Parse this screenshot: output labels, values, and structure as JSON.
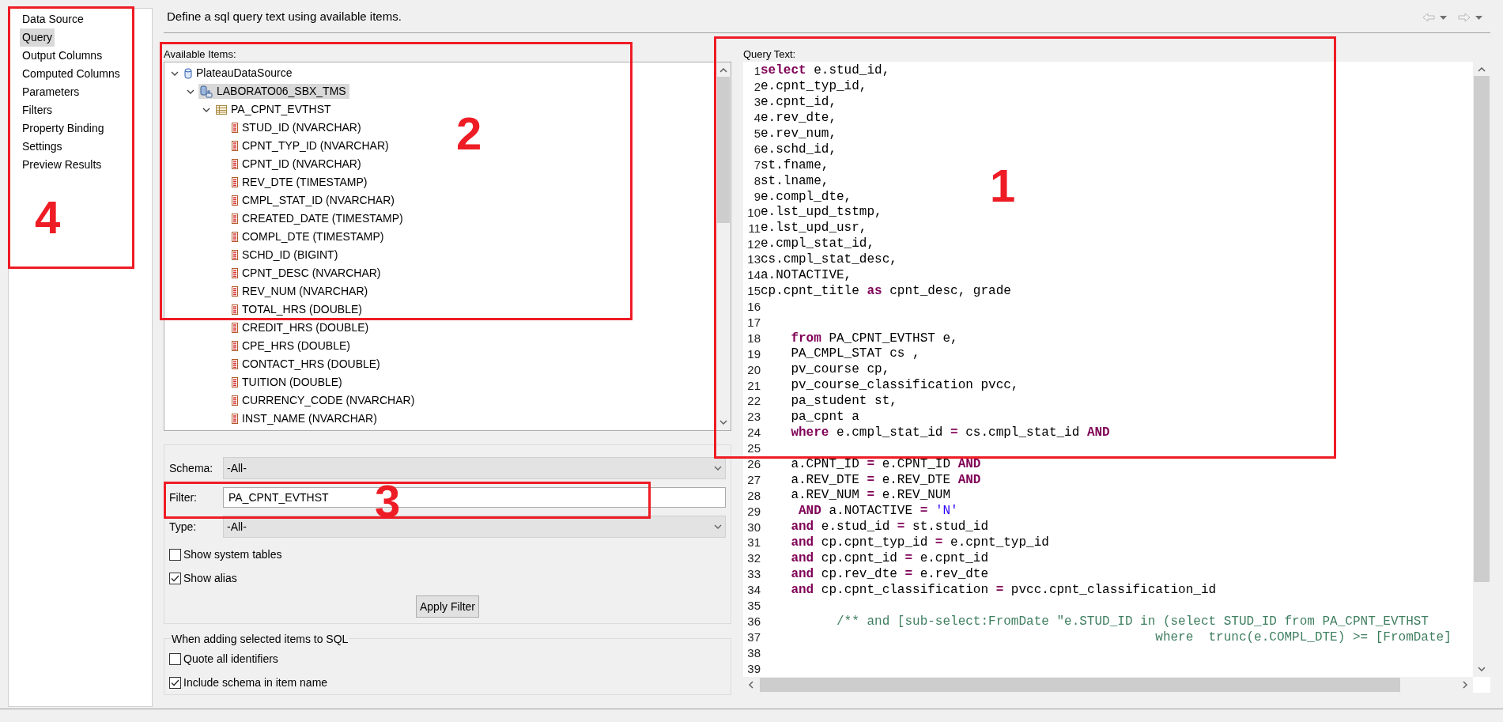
{
  "sidebar": {
    "items": [
      {
        "label": "Data Source",
        "selected": false
      },
      {
        "label": "Query",
        "selected": true
      },
      {
        "label": "Output Columns",
        "selected": false
      },
      {
        "label": "Computed Columns",
        "selected": false
      },
      {
        "label": "Parameters",
        "selected": false
      },
      {
        "label": "Filters",
        "selected": false
      },
      {
        "label": "Property Binding",
        "selected": false
      },
      {
        "label": "Settings",
        "selected": false
      },
      {
        "label": "Preview Results",
        "selected": false
      }
    ]
  },
  "header": {
    "title": "Define a sql query text using available items."
  },
  "available_items": {
    "label": "Available Items:",
    "tree": [
      {
        "label": "PlateauDataSource",
        "kind": "datasource",
        "expanded": true,
        "selected": false,
        "children": [
          {
            "label": "LABORATO06_SBX_TMS",
            "kind": "schema",
            "expanded": true,
            "selected": true,
            "children": [
              {
                "label": "PA_CPNT_EVTHST",
                "kind": "table",
                "expanded": true,
                "selected": false,
                "children": [
                  {
                    "label": "STUD_ID (NVARCHAR)",
                    "kind": "column",
                    "selected": false
                  },
                  {
                    "label": "CPNT_TYP_ID (NVARCHAR)",
                    "kind": "column",
                    "selected": false
                  },
                  {
                    "label": "CPNT_ID (NVARCHAR)",
                    "kind": "column",
                    "selected": false
                  },
                  {
                    "label": "REV_DTE (TIMESTAMP)",
                    "kind": "column",
                    "selected": false
                  },
                  {
                    "label": "CMPL_STAT_ID (NVARCHAR)",
                    "kind": "column",
                    "selected": false
                  },
                  {
                    "label": "CREATED_DATE (TIMESTAMP)",
                    "kind": "column",
                    "selected": false
                  },
                  {
                    "label": "COMPL_DTE (TIMESTAMP)",
                    "kind": "column",
                    "selected": false
                  },
                  {
                    "label": "SCHD_ID (BIGINT)",
                    "kind": "column",
                    "selected": false
                  },
                  {
                    "label": "CPNT_DESC (NVARCHAR)",
                    "kind": "column",
                    "selected": false
                  },
                  {
                    "label": "REV_NUM (NVARCHAR)",
                    "kind": "column",
                    "selected": false
                  },
                  {
                    "label": "TOTAL_HRS (DOUBLE)",
                    "kind": "column",
                    "selected": false
                  },
                  {
                    "label": "CREDIT_HRS (DOUBLE)",
                    "kind": "column",
                    "selected": false
                  },
                  {
                    "label": "CPE_HRS (DOUBLE)",
                    "kind": "column",
                    "selected": false
                  },
                  {
                    "label": "CONTACT_HRS (DOUBLE)",
                    "kind": "column",
                    "selected": false
                  },
                  {
                    "label": "TUITION (DOUBLE)",
                    "kind": "column",
                    "selected": false
                  },
                  {
                    "label": "CURRENCY_CODE (NVARCHAR)",
                    "kind": "column",
                    "selected": false
                  },
                  {
                    "label": "INST_NAME (NVARCHAR)",
                    "kind": "column",
                    "selected": false
                  }
                ]
              }
            ]
          }
        ]
      }
    ]
  },
  "filter_panel": {
    "schema": {
      "label": "Schema:",
      "value": "-All-"
    },
    "filter": {
      "label": "Filter:",
      "value": "PA_CPNT_EVTHST"
    },
    "type": {
      "label": "Type:",
      "value": "-All-"
    },
    "options": [
      {
        "label": "Show system tables",
        "checked": false
      },
      {
        "label": "Show alias",
        "checked": true
      }
    ],
    "apply_button": "Apply Filter"
  },
  "sql_options": {
    "title": "When adding selected items to SQL",
    "options": [
      {
        "label": "Quote all identifiers",
        "checked": false
      },
      {
        "label": "Include schema in item name",
        "checked": true
      }
    ]
  },
  "query": {
    "label": "Query Text:",
    "lines": [
      {
        "number": "1",
        "kind": "code",
        "text": "**select** e.stud_id,"
      },
      {
        "number": "2",
        "kind": "code",
        "text": "e.cpnt_typ_id,"
      },
      {
        "number": "3",
        "kind": "code",
        "text": "e.cpnt_id,"
      },
      {
        "number": "4",
        "kind": "code",
        "text": "e.rev_dte,"
      },
      {
        "number": "5",
        "kind": "code",
        "text": "e.rev_num,"
      },
      {
        "number": "6",
        "kind": "code",
        "text": "e.schd_id,"
      },
      {
        "number": "7",
        "kind": "code",
        "text": "st.fname,"
      },
      {
        "number": "8",
        "kind": "code",
        "text": "st.lname,"
      },
      {
        "number": "9",
        "kind": "code",
        "text": "e.compl_dte,"
      },
      {
        "number": "10",
        "kind": "code",
        "text": "e.lst_upd_tstmp,"
      },
      {
        "number": "11",
        "kind": "code",
        "text": "e.lst_upd_usr,"
      },
      {
        "number": "12",
        "kind": "code",
        "text": "e.cmpl_stat_id,"
      },
      {
        "number": "13",
        "kind": "code",
        "text": "cs.cmpl_stat_desc,"
      },
      {
        "number": "14",
        "kind": "code",
        "text": "a.NOTACTIVE,"
      },
      {
        "number": "15",
        "kind": "code",
        "text": "cp.cpnt_title **as** cpnt_desc, grade"
      },
      {
        "number": "16"
      },
      {
        "number": "17"
      },
      {
        "number": "18",
        "kind": "code",
        "text": "    **from** PA_CPNT_EVTHST e,"
      },
      {
        "number": "19",
        "kind": "code",
        "text": "    PA_CMPL_STAT cs ,"
      },
      {
        "number": "20",
        "kind": "code",
        "text": "    pv_course cp,"
      },
      {
        "number": "21",
        "kind": "code",
        "text": "    pv_course_classification pvcc,"
      },
      {
        "number": "22",
        "kind": "code",
        "text": "    pa_student st,"
      },
      {
        "number": "23",
        "kind": "code",
        "text": "    pa_cpnt a"
      },
      {
        "number": "24",
        "kind": "code",
        "text": "    **where** e.cmpl_stat_id **=** cs.cmpl_stat_id **AND**"
      },
      {
        "number": "25"
      },
      {
        "number": "26",
        "kind": "code",
        "text": "    a.CPNT_ID **=** e.CPNT_ID **AND**"
      },
      {
        "number": "27",
        "kind": "code",
        "text": "    a.REV_DTE **=** e.REV_DTE **AND**"
      },
      {
        "number": "28",
        "kind": "code",
        "text": "    a.REV_NUM **=** e.REV_NUM"
      },
      {
        "number": "29",
        "kind": "code",
        "text": "     **AND** a.NOTACTIVE **=** *'N'*"
      },
      {
        "number": "30",
        "kind": "code",
        "text": "    **and** e.stud_id **=** st.stud_id"
      },
      {
        "number": "31",
        "kind": "code",
        "text": "    **and** cp.cpnt_typ_id **=** e.cpnt_typ_id"
      },
      {
        "number": "32",
        "kind": "code",
        "text": "    **and** cp.cpnt_id **=** e.cpnt_id"
      },
      {
        "number": "33",
        "kind": "code",
        "text": "    **and** cp.rev_dte **=** e.rev_dte"
      },
      {
        "number": "34",
        "kind": "code",
        "text": "    **and** cp.cpnt_classification **=** pvcc.cpnt_classification_id"
      },
      {
        "number": "35"
      },
      {
        "number": "36",
        "kind": "comment",
        "text": "          /** and [sub-select:FromDate \"e.STUD_ID in (select STUD_ID from PA_CPNT_EVTHST"
      },
      {
        "number": "37",
        "kind": "comment",
        "text": "                                                    where  trunc(e.COMPL_DTE) >= [FromDate]"
      },
      {
        "number": "38"
      },
      {
        "number": "39"
      }
    ]
  },
  "annotations": [
    {
      "label": "1"
    },
    {
      "label": "2"
    },
    {
      "label": "3"
    },
    {
      "label": "4"
    }
  ]
}
